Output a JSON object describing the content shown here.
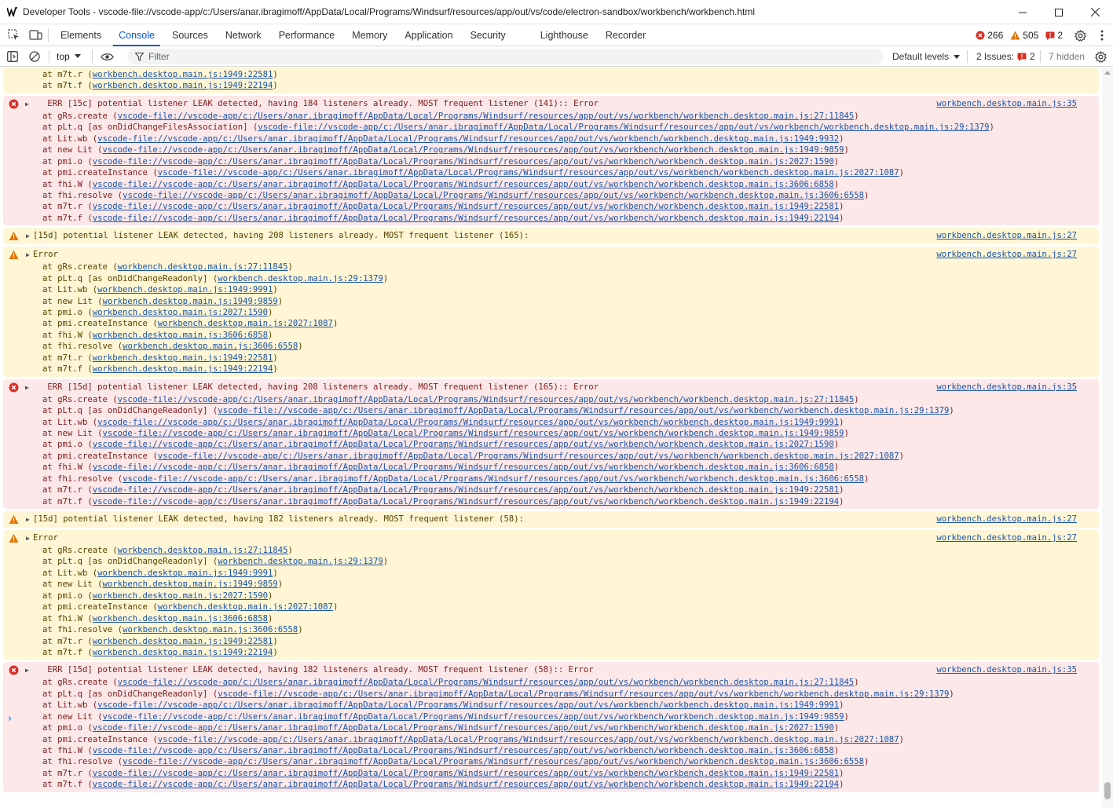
{
  "window": {
    "title": "Developer Tools - vscode-file://vscode-app/c:/Users/anar.ibragimoff/AppData/Local/Programs/Windsurf/resources/app/out/vs/code/electron-sandbox/workbench/workbench.html"
  },
  "tabs": [
    {
      "label": "Elements",
      "active": false
    },
    {
      "label": "Console",
      "active": true
    },
    {
      "label": "Sources",
      "active": false
    },
    {
      "label": "Network",
      "active": false
    },
    {
      "label": "Performance",
      "active": false
    },
    {
      "label": "Memory",
      "active": false
    },
    {
      "label": "Application",
      "active": false
    },
    {
      "label": "Security",
      "active": false
    },
    {
      "label": "Lighthouse",
      "active": false
    },
    {
      "label": "Recorder",
      "active": false
    }
  ],
  "counters": {
    "errors": "266",
    "warnings": "505",
    "issues": "2"
  },
  "console_toolbar": {
    "context": "top",
    "filter_placeholder": "Filter",
    "levels": "Default levels",
    "issues_label": "2 Issues:",
    "issues_count": "2",
    "hidden": "7 hidden"
  },
  "colors": {
    "accent": "#0b57d0",
    "error": "#d93025",
    "warning": "#e37400",
    "link": "#1a53a8"
  },
  "messages": [
    {
      "type": "warn",
      "partial": true,
      "lines": [
        {
          "pre": "at m7t.r (",
          "link": "workbench.desktop.main.js:1949:22581",
          "post": ")"
        },
        {
          "pre": "at m7t.f (",
          "link": "workbench.desktop.main.js:1949:22194",
          "post": ")"
        }
      ]
    },
    {
      "type": "err",
      "head": " ERR [15c] potential listener LEAK detected, having 184 listeners already. MOST frequent listener (141):: Error",
      "source": "workbench.desktop.main.js:35",
      "lines": [
        {
          "pre": "at gRs.create (",
          "link": "vscode-file://vscode-app/c:/Users/anar.ibragimoff/AppData/Local/Programs/Windsurf/resources/app/out/vs/workbench/workbench.desktop.main.js:27:11845",
          "post": ")"
        },
        {
          "pre": "at pLt.q [as onDidChangeFilesAssociation] (",
          "link": "vscode-file://vscode-app/c:/Users/anar.ibragimoff/AppData/Local/Programs/Windsurf/resources/app/out/vs/workbench/workbench.desktop.main.js:29:1379",
          "post": ")"
        },
        {
          "pre": "at Lit.wb (",
          "link": "vscode-file://vscode-app/c:/Users/anar.ibragimoff/AppData/Local/Programs/Windsurf/resources/app/out/vs/workbench/workbench.desktop.main.js:1949:9932",
          "post": ")"
        },
        {
          "pre": "at new Lit (",
          "link": "vscode-file://vscode-app/c:/Users/anar.ibragimoff/AppData/Local/Programs/Windsurf/resources/app/out/vs/workbench/workbench.desktop.main.js:1949:9859",
          "post": ")"
        },
        {
          "pre": "at pmi.o (",
          "link": "vscode-file://vscode-app/c:/Users/anar.ibragimoff/AppData/Local/Programs/Windsurf/resources/app/out/vs/workbench/workbench.desktop.main.js:2027:1590",
          "post": ")"
        },
        {
          "pre": "at pmi.createInstance (",
          "link": "vscode-file://vscode-app/c:/Users/anar.ibragimoff/AppData/Local/Programs/Windsurf/resources/app/out/vs/workbench/workbench.desktop.main.js:2027:1087",
          "post": ")"
        },
        {
          "pre": "at fhi.W (",
          "link": "vscode-file://vscode-app/c:/Users/anar.ibragimoff/AppData/Local/Programs/Windsurf/resources/app/out/vs/workbench/workbench.desktop.main.js:3606:6858",
          "post": ")"
        },
        {
          "pre": "at fhi.resolve (",
          "link": "vscode-file://vscode-app/c:/Users/anar.ibragimoff/AppData/Local/Programs/Windsurf/resources/app/out/vs/workbench/workbench.desktop.main.js:3606:6558",
          "post": ")"
        },
        {
          "pre": "at m7t.r (",
          "link": "vscode-file://vscode-app/c:/Users/anar.ibragimoff/AppData/Local/Programs/Windsurf/resources/app/out/vs/workbench/workbench.desktop.main.js:1949:22581",
          "post": ")"
        },
        {
          "pre": "at m7t.f (",
          "link": "vscode-file://vscode-app/c:/Users/anar.ibragimoff/AppData/Local/Programs/Windsurf/resources/app/out/vs/workbench/workbench.desktop.main.js:1949:22194",
          "post": ")"
        }
      ]
    },
    {
      "type": "warn",
      "head": "[15d] potential listener LEAK detected, having 208 listeners already. MOST frequent listener (165):",
      "source": "workbench.desktop.main.js:27",
      "lines": []
    },
    {
      "type": "warn",
      "head": "Error",
      "source": "workbench.desktop.main.js:27",
      "lines": [
        {
          "pre": "at gRs.create (",
          "link": "workbench.desktop.main.js:27:11845",
          "post": ")"
        },
        {
          "pre": "at pLt.q [as onDidChangeReadonly] (",
          "link": "workbench.desktop.main.js:29:1379",
          "post": ")"
        },
        {
          "pre": "at Lit.wb (",
          "link": "workbench.desktop.main.js:1949:9991",
          "post": ")"
        },
        {
          "pre": "at new Lit (",
          "link": "workbench.desktop.main.js:1949:9859",
          "post": ")"
        },
        {
          "pre": "at pmi.o (",
          "link": "workbench.desktop.main.js:2027:1590",
          "post": ")"
        },
        {
          "pre": "at pmi.createInstance (",
          "link": "workbench.desktop.main.js:2027:1087",
          "post": ")"
        },
        {
          "pre": "at fhi.W (",
          "link": "workbench.desktop.main.js:3606:6858",
          "post": ")"
        },
        {
          "pre": "at fhi.resolve (",
          "link": "workbench.desktop.main.js:3606:6558",
          "post": ")"
        },
        {
          "pre": "at m7t.r (",
          "link": "workbench.desktop.main.js:1949:22581",
          "post": ")"
        },
        {
          "pre": "at m7t.f (",
          "link": "workbench.desktop.main.js:1949:22194",
          "post": ")"
        }
      ]
    },
    {
      "type": "err",
      "head": " ERR [15d] potential listener LEAK detected, having 208 listeners already. MOST frequent listener (165):: Error",
      "source": "workbench.desktop.main.js:35",
      "lines": [
        {
          "pre": "at gRs.create (",
          "link": "vscode-file://vscode-app/c:/Users/anar.ibragimoff/AppData/Local/Programs/Windsurf/resources/app/out/vs/workbench/workbench.desktop.main.js:27:11845",
          "post": ")"
        },
        {
          "pre": "at pLt.q [as onDidChangeReadonly] (",
          "link": "vscode-file://vscode-app/c:/Users/anar.ibragimoff/AppData/Local/Programs/Windsurf/resources/app/out/vs/workbench/workbench.desktop.main.js:29:1379",
          "post": ")"
        },
        {
          "pre": "at Lit.wb (",
          "link": "vscode-file://vscode-app/c:/Users/anar.ibragimoff/AppData/Local/Programs/Windsurf/resources/app/out/vs/workbench/workbench.desktop.main.js:1949:9991",
          "post": ")"
        },
        {
          "pre": "at new Lit (",
          "link": "vscode-file://vscode-app/c:/Users/anar.ibragimoff/AppData/Local/Programs/Windsurf/resources/app/out/vs/workbench/workbench.desktop.main.js:1949:9859",
          "post": ")"
        },
        {
          "pre": "at pmi.o (",
          "link": "vscode-file://vscode-app/c:/Users/anar.ibragimoff/AppData/Local/Programs/Windsurf/resources/app/out/vs/workbench/workbench.desktop.main.js:2027:1590",
          "post": ")"
        },
        {
          "pre": "at pmi.createInstance (",
          "link": "vscode-file://vscode-app/c:/Users/anar.ibragimoff/AppData/Local/Programs/Windsurf/resources/app/out/vs/workbench/workbench.desktop.main.js:2027:1087",
          "post": ")"
        },
        {
          "pre": "at fhi.W (",
          "link": "vscode-file://vscode-app/c:/Users/anar.ibragimoff/AppData/Local/Programs/Windsurf/resources/app/out/vs/workbench/workbench.desktop.main.js:3606:6858",
          "post": ")"
        },
        {
          "pre": "at fhi.resolve (",
          "link": "vscode-file://vscode-app/c:/Users/anar.ibragimoff/AppData/Local/Programs/Windsurf/resources/app/out/vs/workbench/workbench.desktop.main.js:3606:6558",
          "post": ")"
        },
        {
          "pre": "at m7t.r (",
          "link": "vscode-file://vscode-app/c:/Users/anar.ibragimoff/AppData/Local/Programs/Windsurf/resources/app/out/vs/workbench/workbench.desktop.main.js:1949:22581",
          "post": ")"
        },
        {
          "pre": "at m7t.f (",
          "link": "vscode-file://vscode-app/c:/Users/anar.ibragimoff/AppData/Local/Programs/Windsurf/resources/app/out/vs/workbench/workbench.desktop.main.js:1949:22194",
          "post": ")"
        }
      ]
    },
    {
      "type": "warn",
      "head": "[15d] potential listener LEAK detected, having 182 listeners already. MOST frequent listener (58):",
      "source": "workbench.desktop.main.js:27",
      "lines": []
    },
    {
      "type": "warn",
      "head": "Error",
      "source": "workbench.desktop.main.js:27",
      "lines": [
        {
          "pre": "at gRs.create (",
          "link": "workbench.desktop.main.js:27:11845",
          "post": ")"
        },
        {
          "pre": "at pLt.q [as onDidChangeReadonly] (",
          "link": "workbench.desktop.main.js:29:1379",
          "post": ")"
        },
        {
          "pre": "at Lit.wb (",
          "link": "workbench.desktop.main.js:1949:9991",
          "post": ")"
        },
        {
          "pre": "at new Lit (",
          "link": "workbench.desktop.main.js:1949:9859",
          "post": ")"
        },
        {
          "pre": "at pmi.o (",
          "link": "workbench.desktop.main.js:2027:1590",
          "post": ")"
        },
        {
          "pre": "at pmi.createInstance (",
          "link": "workbench.desktop.main.js:2027:1087",
          "post": ")"
        },
        {
          "pre": "at fhi.W (",
          "link": "workbench.desktop.main.js:3606:6858",
          "post": ")"
        },
        {
          "pre": "at fhi.resolve (",
          "link": "workbench.desktop.main.js:3606:6558",
          "post": ")"
        },
        {
          "pre": "at m7t.r (",
          "link": "workbench.desktop.main.js:1949:22581",
          "post": ")"
        },
        {
          "pre": "at m7t.f (",
          "link": "workbench.desktop.main.js:1949:22194",
          "post": ")"
        }
      ]
    },
    {
      "type": "err",
      "head": " ERR [15d] potential listener LEAK detected, having 182 listeners already. MOST frequent listener (58):: Error",
      "source": "workbench.desktop.main.js:35",
      "lines": [
        {
          "pre": "at gRs.create (",
          "link": "vscode-file://vscode-app/c:/Users/anar.ibragimoff/AppData/Local/Programs/Windsurf/resources/app/out/vs/workbench/workbench.desktop.main.js:27:11845",
          "post": ")"
        },
        {
          "pre": "at pLt.q [as onDidChangeReadonly] (",
          "link": "vscode-file://vscode-app/c:/Users/anar.ibragimoff/AppData/Local/Programs/Windsurf/resources/app/out/vs/workbench/workbench.desktop.main.js:29:1379",
          "post": ")"
        },
        {
          "pre": "at Lit.wb (",
          "link": "vscode-file://vscode-app/c:/Users/anar.ibragimoff/AppData/Local/Programs/Windsurf/resources/app/out/vs/workbench/workbench.desktop.main.js:1949:9991",
          "post": ")"
        },
        {
          "pre": "at new Lit (",
          "link": "vscode-file://vscode-app/c:/Users/anar.ibragimoff/AppData/Local/Programs/Windsurf/resources/app/out/vs/workbench/workbench.desktop.main.js:1949:9859",
          "post": ")"
        },
        {
          "pre": "at pmi.o (",
          "link": "vscode-file://vscode-app/c:/Users/anar.ibragimoff/AppData/Local/Programs/Windsurf/resources/app/out/vs/workbench/workbench.desktop.main.js:2027:1590",
          "post": ")"
        },
        {
          "pre": "at pmi.createInstance (",
          "link": "vscode-file://vscode-app/c:/Users/anar.ibragimoff/AppData/Local/Programs/Windsurf/resources/app/out/vs/workbench/workbench.desktop.main.js:2027:1087",
          "post": ")"
        },
        {
          "pre": "at fhi.W (",
          "link": "vscode-file://vscode-app/c:/Users/anar.ibragimoff/AppData/Local/Programs/Windsurf/resources/app/out/vs/workbench/workbench.desktop.main.js:3606:6858",
          "post": ")"
        },
        {
          "pre": "at fhi.resolve (",
          "link": "vscode-file://vscode-app/c:/Users/anar.ibragimoff/AppData/Local/Programs/Windsurf/resources/app/out/vs/workbench/workbench.desktop.main.js:3606:6558",
          "post": ")"
        },
        {
          "pre": "at m7t.r (",
          "link": "vscode-file://vscode-app/c:/Users/anar.ibragimoff/AppData/Local/Programs/Windsurf/resources/app/out/vs/workbench/workbench.desktop.main.js:1949:22581",
          "post": ")"
        },
        {
          "pre": "at m7t.f (",
          "link": "vscode-file://vscode-app/c:/Users/anar.ibragimoff/AppData/Local/Programs/Windsurf/resources/app/out/vs/workbench/workbench.desktop.main.js:1949:22194",
          "post": ")"
        }
      ]
    }
  ]
}
